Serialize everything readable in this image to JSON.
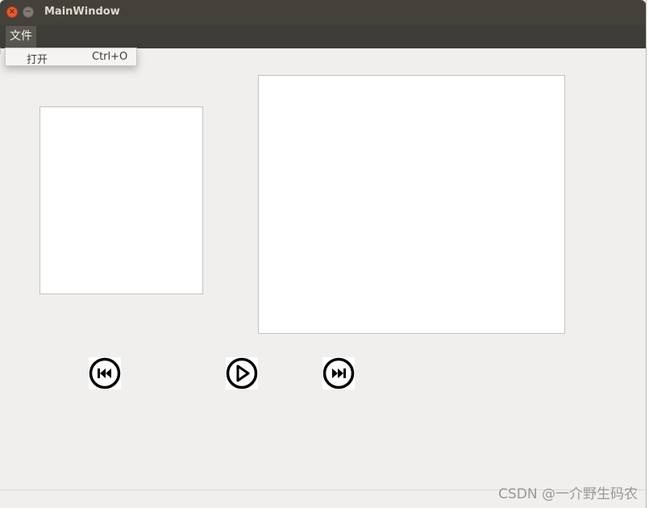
{
  "window": {
    "title": "MainWindow",
    "close_glyph": "×",
    "minimize_glyph": "−"
  },
  "menubar": {
    "file_label": "文件"
  },
  "file_menu": {
    "items": [
      {
        "label": "打开",
        "shortcut": "Ctrl+O"
      }
    ]
  },
  "controls": {
    "previous_icon": "skip-previous-icon",
    "play_icon": "play-icon",
    "next_icon": "skip-next-icon"
  },
  "watermark": "CSDN @一介野生码农",
  "colors": {
    "titlebar": "#434139",
    "menubar": "#3f3d37",
    "close_button": "#e55b2f",
    "window_bg": "#f0efed"
  }
}
